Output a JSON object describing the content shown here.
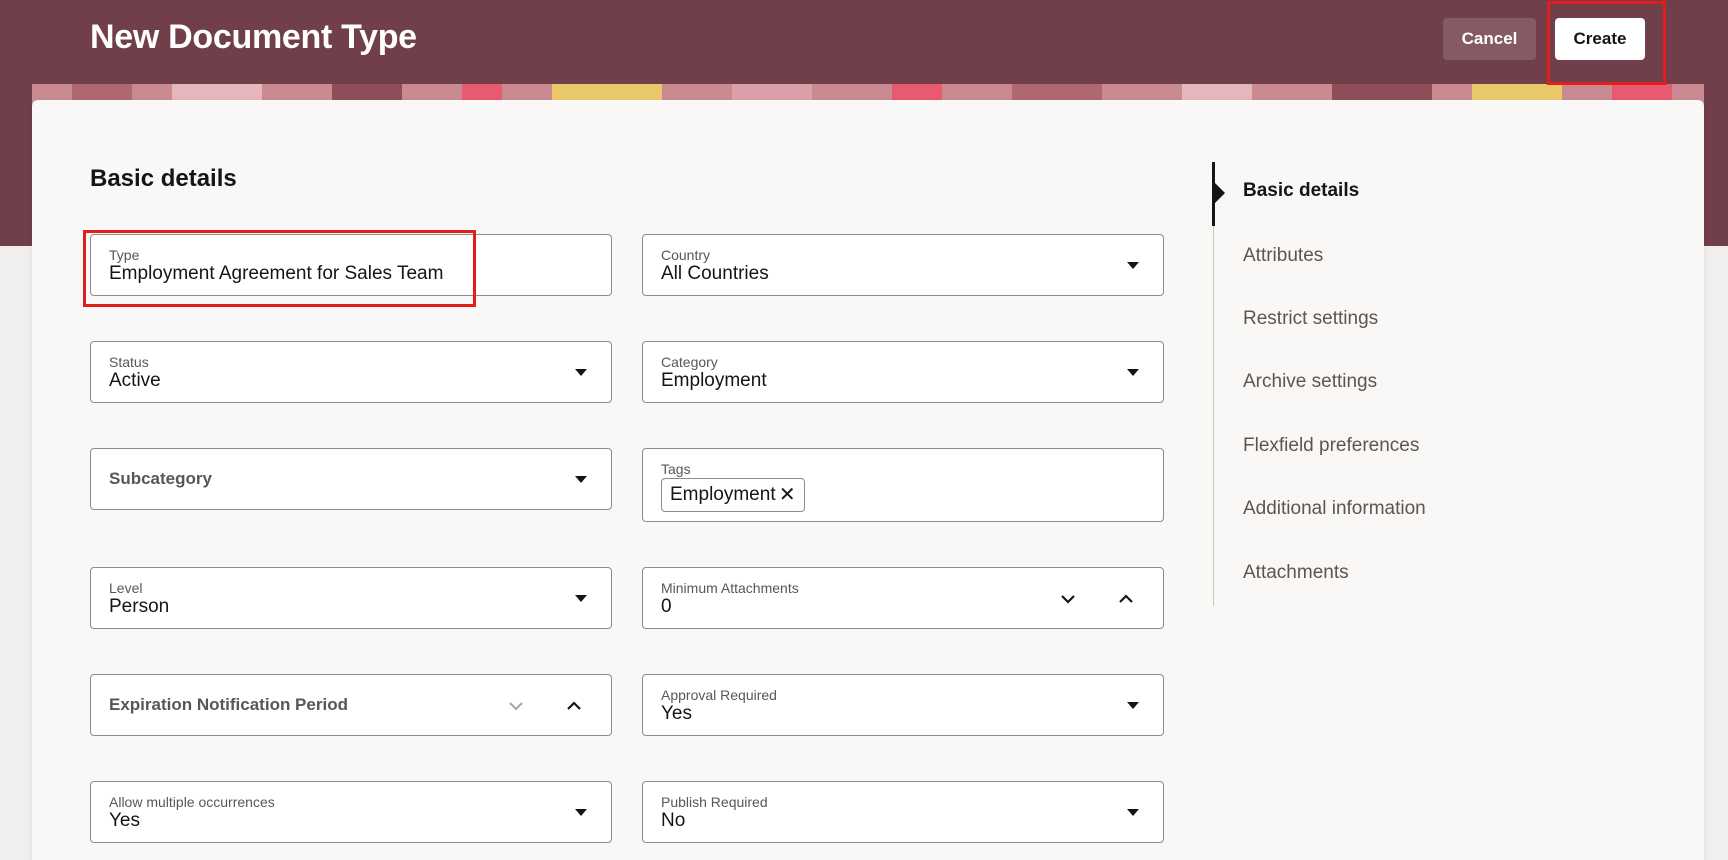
{
  "header": {
    "title": "New Document Type",
    "cancel_label": "Cancel",
    "create_label": "Create"
  },
  "section": {
    "title": "Basic details"
  },
  "fields": {
    "type": {
      "label": "Type",
      "value": "Employment Agreement for Sales Team"
    },
    "country": {
      "label": "Country",
      "value": "All Countries"
    },
    "status": {
      "label": "Status",
      "value": "Active"
    },
    "category": {
      "label": "Category",
      "value": "Employment"
    },
    "subcategory": {
      "label": "Subcategory"
    },
    "tags": {
      "label": "Tags",
      "chip": "Employment",
      "chip_remove": "✕"
    },
    "level": {
      "label": "Level",
      "value": "Person"
    },
    "min_attachments": {
      "label": "Minimum Attachments",
      "value": "0"
    },
    "expiration": {
      "label": "Expiration Notification Period"
    },
    "approval": {
      "label": "Approval Required",
      "value": "Yes"
    },
    "multiple": {
      "label": "Allow multiple occurrences",
      "value": "Yes"
    },
    "publish": {
      "label": "Publish Required",
      "value": "No"
    }
  },
  "nav": {
    "items": [
      {
        "label": "Basic details"
      },
      {
        "label": "Attributes"
      },
      {
        "label": "Restrict settings"
      },
      {
        "label": "Archive settings"
      },
      {
        "label": "Flexfield preferences"
      },
      {
        "label": "Additional information"
      },
      {
        "label": "Attachments"
      }
    ]
  },
  "colors": {
    "header_bg": "#713f4a",
    "highlight": "#e01e1e"
  }
}
